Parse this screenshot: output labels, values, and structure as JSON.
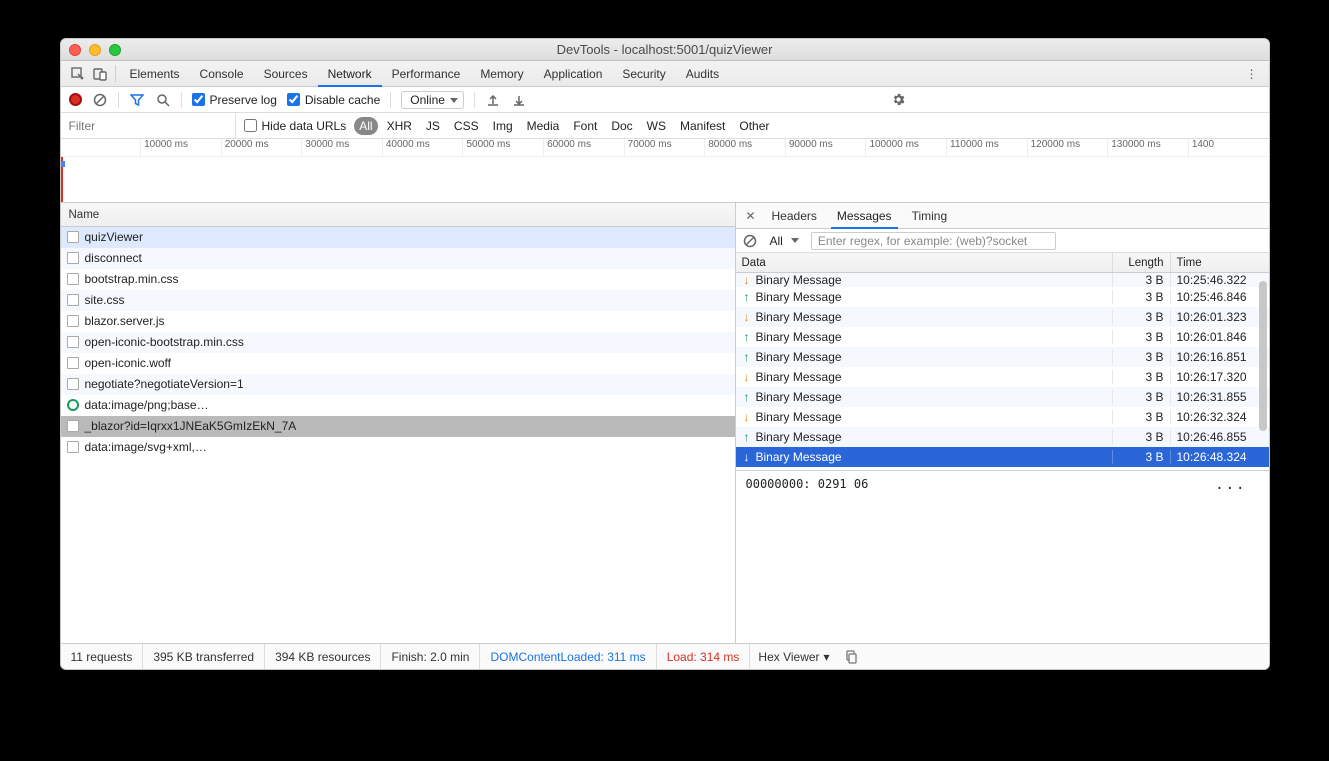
{
  "window_title": "DevTools - localhost:5001/quizViewer",
  "top_tabs": {
    "elements": "Elements",
    "console": "Console",
    "sources": "Sources",
    "network": "Network",
    "performance": "Performance",
    "memory": "Memory",
    "application": "Application",
    "security": "Security",
    "audits": "Audits"
  },
  "toolbar": {
    "preserve_log": "Preserve log",
    "disable_cache": "Disable cache",
    "throttling": "Online"
  },
  "filter": {
    "placeholder": "Filter",
    "hide_data_urls": "Hide data URLs",
    "types": {
      "all": "All",
      "xhr": "XHR",
      "js": "JS",
      "css": "CSS",
      "img": "Img",
      "media": "Media",
      "font": "Font",
      "doc": "Doc",
      "ws": "WS",
      "manifest": "Manifest",
      "other": "Other"
    }
  },
  "timeline_ticks": [
    "",
    "10000 ms",
    "20000 ms",
    "30000 ms",
    "40000 ms",
    "50000 ms",
    "60000 ms",
    "70000 ms",
    "80000 ms",
    "90000 ms",
    "100000 ms",
    "110000 ms",
    "120000 ms",
    "130000 ms",
    "1400"
  ],
  "left": {
    "header": "Name",
    "rows": [
      {
        "name": "quizViewer"
      },
      {
        "name": "disconnect"
      },
      {
        "name": "bootstrap.min.css"
      },
      {
        "name": "site.css"
      },
      {
        "name": "blazor.server.js"
      },
      {
        "name": "open-iconic-bootstrap.min.css"
      },
      {
        "name": "open-iconic.woff"
      },
      {
        "name": "negotiate?negotiateVersion=1"
      },
      {
        "name": "data:image/png;base…"
      },
      {
        "name": "_blazor?id=Iqrxx1JNEaK5GmIzEkN_7A"
      },
      {
        "name": "data:image/svg+xml,…"
      }
    ],
    "selected_index": 0,
    "highlight_index": 9
  },
  "right_tabs": {
    "headers": "Headers",
    "messages": "Messages",
    "timing": "Timing"
  },
  "msgbar": {
    "filter_all": "All",
    "regex_placeholder": "Enter regex, for example: (web)?socket"
  },
  "msg_head": {
    "data": "Data",
    "length": "Length",
    "time": "Time"
  },
  "messages": [
    {
      "dir": "dn",
      "text": "Binary Message",
      "len": "3 B",
      "time": "10:25:46.322",
      "cut": true
    },
    {
      "dir": "up",
      "text": "Binary Message",
      "len": "3 B",
      "time": "10:25:46.846"
    },
    {
      "dir": "dn",
      "text": "Binary Message",
      "len": "3 B",
      "time": "10:26:01.323"
    },
    {
      "dir": "up",
      "text": "Binary Message",
      "len": "3 B",
      "time": "10:26:01.846"
    },
    {
      "dir": "up",
      "text": "Binary Message",
      "len": "3 B",
      "time": "10:26:16.851"
    },
    {
      "dir": "dn",
      "text": "Binary Message",
      "len": "3 B",
      "time": "10:26:17.320"
    },
    {
      "dir": "up",
      "text": "Binary Message",
      "len": "3 B",
      "time": "10:26:31.855"
    },
    {
      "dir": "dn",
      "text": "Binary Message",
      "len": "3 B",
      "time": "10:26:32.324"
    },
    {
      "dir": "up",
      "text": "Binary Message",
      "len": "3 B",
      "time": "10:26:46.855"
    },
    {
      "dir": "dn",
      "text": "Binary Message",
      "len": "3 B",
      "time": "10:26:48.324",
      "sel": true
    }
  ],
  "hex_line": "00000000: 0291 06",
  "status": {
    "requests": "11 requests",
    "transferred": "395 KB transferred",
    "resources": "394 KB resources",
    "finish": "Finish: 2.0 min",
    "dcl": "DOMContentLoaded: 311 ms",
    "load": "Load: 314 ms",
    "hex_viewer": "Hex Viewer"
  }
}
